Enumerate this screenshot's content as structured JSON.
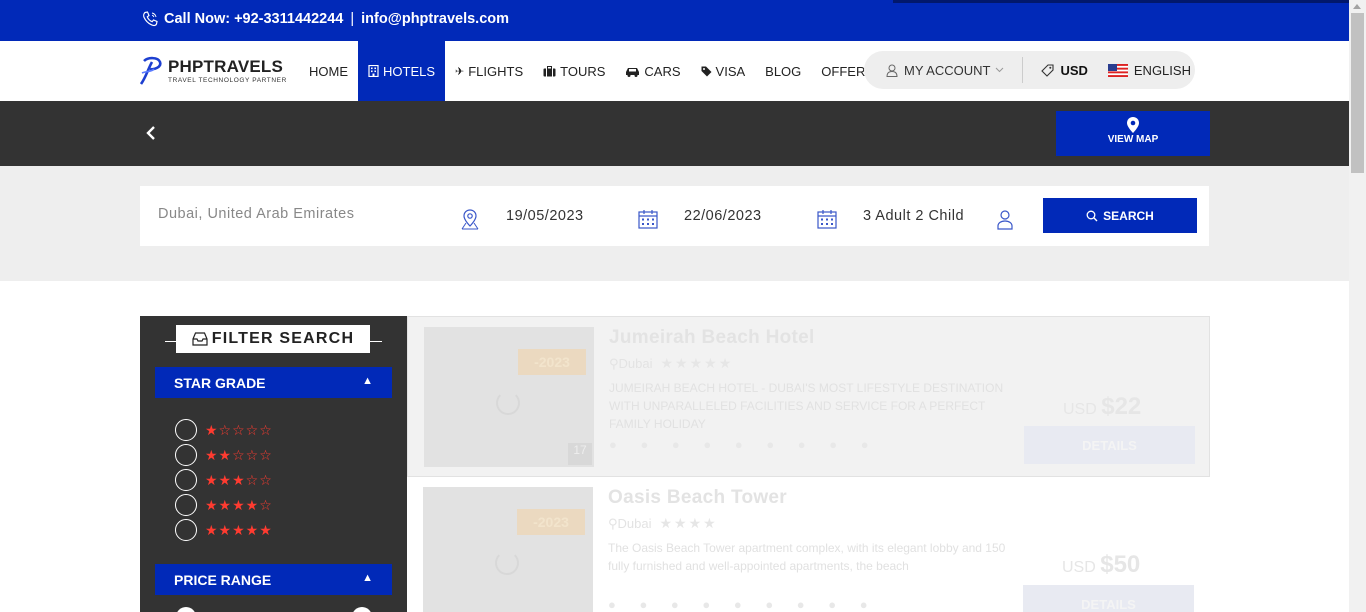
{
  "topbar": {
    "call_label": "Call Now:",
    "phone": "+92-3311442244",
    "separator": "|",
    "email": "info@phptravels.com"
  },
  "brand": {
    "name": "PHPTRAVELS",
    "tagline": "TRAVEL TECHNOLOGY PARTNER"
  },
  "nav": {
    "items": [
      {
        "label": "HOME",
        "icon": "",
        "active": false
      },
      {
        "label": "HOTELS",
        "icon": "hotel-icon",
        "active": true
      },
      {
        "label": "FLIGHTS",
        "icon": "plane-icon",
        "active": false
      },
      {
        "label": "TOURS",
        "icon": "suitcase-icon",
        "active": false
      },
      {
        "label": "CARS",
        "icon": "car-icon",
        "active": false
      },
      {
        "label": "VISA",
        "icon": "tag-icon",
        "active": false
      },
      {
        "label": "BLOG",
        "icon": "",
        "active": false
      },
      {
        "label": "OFFERS",
        "icon": "",
        "active": false
      }
    ],
    "account": "MY ACCOUNT",
    "currency": "USD",
    "language": "ENGLISH"
  },
  "band": {
    "view_map": "VIEW MAP"
  },
  "search": {
    "destination_placeholder": "Dubai, United Arab Emirates",
    "checkin": "19/05/2023",
    "checkout": "22/06/2023",
    "guests": "3 Adult 2 Child",
    "button": "SEARCH"
  },
  "filters": {
    "title": "FILTER SEARCH",
    "star_grade": "STAR GRADE",
    "star_options": [
      "★☆☆☆☆",
      "★★☆☆☆",
      "★★★☆☆",
      "★★★★☆",
      "★★★★★"
    ],
    "price_range": "PRICE RANGE"
  },
  "results": [
    {
      "name": "Jumeirah Beach Hotel",
      "location": "Dubai",
      "stars": "★★★★★",
      "discount": "-2023",
      "photo_count": "17",
      "description": "JUMEIRAH BEACH HOTEL - DUBAI'S MOST LIFESTYLE DESTINATION WITH UNPARALLELED FACILITIES AND SERVICE FOR A PERFECT FAMILY HOLIDAY",
      "currency": "USD",
      "price": "$22",
      "button": "DETAILS"
    },
    {
      "name": "Oasis Beach Tower",
      "location": "Dubai",
      "stars": "★★★★",
      "discount": "-2023",
      "photo_count": "",
      "description": "The Oasis Beach Tower apartment complex, with its elegant lobby and 150 fully furnished and well-appointed apartments, the beach",
      "currency": "USD",
      "price": "$50",
      "button": "DETAILS"
    }
  ],
  "colors": {
    "primary": "#0129b8",
    "dark": "#333333",
    "star": "#ff3b30",
    "light_bg": "#eeeeee"
  }
}
